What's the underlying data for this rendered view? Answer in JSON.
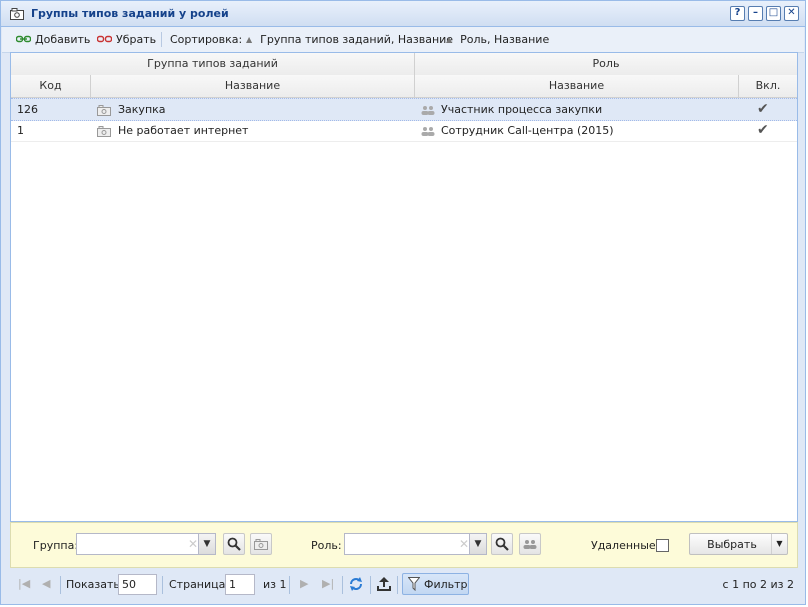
{
  "window": {
    "title": "Группы типов заданий у ролей",
    "controls": [
      "?",
      "–",
      "□",
      "✕"
    ]
  },
  "toolbar": {
    "add_label": "Добавить",
    "remove_label": "Убрать",
    "sort_label": "Сортировка:",
    "sort1_label": "Группа типов заданий, Название",
    "sort2_label": "Роль, Название"
  },
  "grid": {
    "group_header": "Группа типов заданий",
    "role_header": "Роль",
    "columns": {
      "code": "Код",
      "name": "Название",
      "role_name": "Название",
      "included": "Вкл."
    },
    "rows": [
      {
        "code": "126",
        "name": "Закупка",
        "role": "Участник процесса закупки",
        "included": "✔"
      },
      {
        "code": "1",
        "name": "Не работает интернет",
        "role": "Сотрудник Call-центра (2015)",
        "included": "✔"
      }
    ]
  },
  "filter": {
    "group_label": "Группа:",
    "group_value": "",
    "role_label": "Роль:",
    "role_value": "",
    "deleted_label": "Удаленные:",
    "select_label": "Выбрать"
  },
  "pager": {
    "show_label": "Показать",
    "page_size": "50",
    "page_label": "Страница",
    "page_value": "1",
    "of_label": "из 1",
    "filter_label": "Фильтр",
    "summary": "с 1 по 2 из 2"
  }
}
